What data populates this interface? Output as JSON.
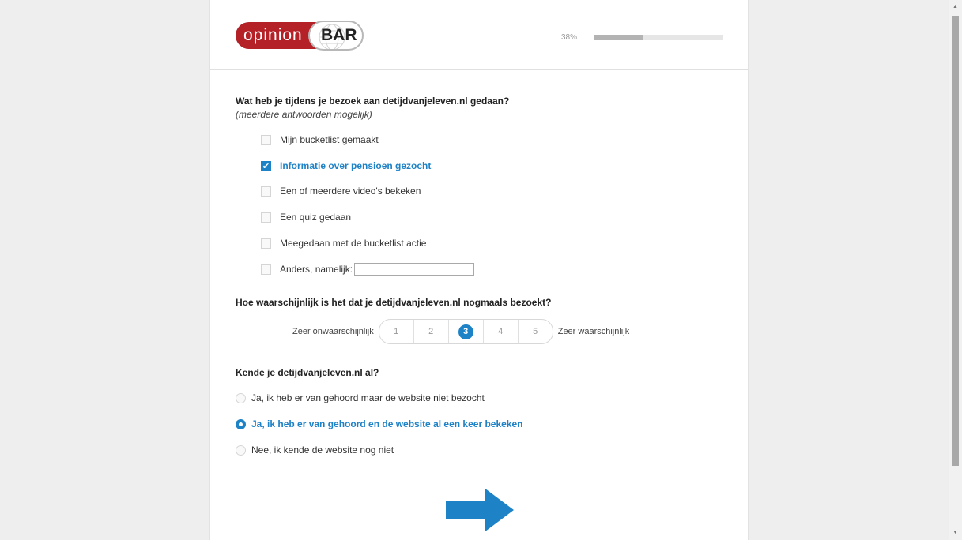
{
  "header": {
    "logo_text_left": "opinion",
    "logo_text_right": "BAR",
    "progress_label": "38%",
    "progress_value": 0.38
  },
  "q1": {
    "title": "Wat heb je tijdens je bezoek aan detijdvanjeleven.nl gedaan?",
    "hint": "(meerdere antwoorden mogelijk)",
    "options": [
      {
        "label": "Mijn bucketlist gemaakt",
        "checked": false
      },
      {
        "label": "Informatie over pensioen gezocht",
        "checked": true
      },
      {
        "label": "Een of meerdere video's bekeken",
        "checked": false
      },
      {
        "label": "Een quiz gedaan",
        "checked": false
      },
      {
        "label": "Meegedaan met de bucketlist actie",
        "checked": false
      },
      {
        "label": "Anders, namelijk:",
        "checked": false
      }
    ],
    "other_value": ""
  },
  "q2": {
    "title": "Hoe waarschijnlijk is het dat je detijdvanjeleven.nl nogmaals bezoekt?",
    "low_label": "Zeer onwaarschijnlijk",
    "high_label": "Zeer waarschijnlijk",
    "scale": [
      "1",
      "2",
      "3",
      "4",
      "5"
    ],
    "selected": "3"
  },
  "q3": {
    "title": "Kende je detijdvanjeleven.nl al?",
    "options": [
      {
        "label": "Ja, ik heb er van gehoord maar de website niet bezocht",
        "checked": false
      },
      {
        "label": "Ja, ik heb er van gehoord en de website al een keer bekeken",
        "checked": true
      },
      {
        "label": "Nee, ik kende de website nog niet",
        "checked": false
      }
    ]
  },
  "colors": {
    "accent": "#1e82c6",
    "brand": "#b42127"
  },
  "icons": {
    "next": "arrow-right-icon",
    "check": "checkmark-icon"
  }
}
